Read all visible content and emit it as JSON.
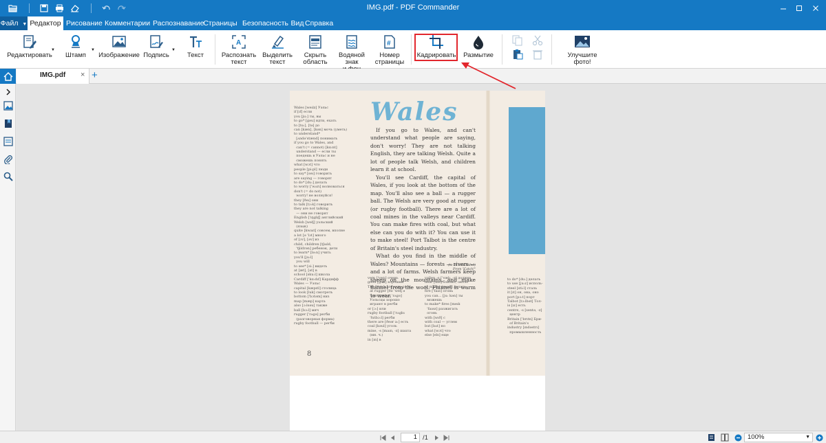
{
  "window": {
    "title": "IMG.pdf - PDF Commander"
  },
  "menu": {
    "file": "Файл",
    "items": [
      "Редактор",
      "Рисование",
      "Комментарии",
      "Распознавание",
      "Страницы",
      "Безопасность",
      "Вид",
      "Справка"
    ],
    "active": "Редактор"
  },
  "ribbon": {
    "edit": "Редактировать",
    "stamp": "Штамп",
    "image": "Изображение",
    "signature": "Подпись",
    "text": "Текст",
    "recognize_line1": "Распознать",
    "recognize_line2": "текст",
    "highlight_line1": "Выделить",
    "highlight_line2": "текст",
    "hide_line1": "Скрыть",
    "hide_line2": "область",
    "watermark_line1": "Водяной знак",
    "watermark_line2": "и фон",
    "pagenum_line1": "Номер",
    "pagenum_line2": "страницы",
    "crop": "Кадрировать",
    "blur": "Размытие",
    "enhance": "Улучшите фото!",
    "highlight_color": "#e2262c"
  },
  "tabs": {
    "document": "IMG.pdf",
    "close_glyph": "×",
    "add_glyph": "+"
  },
  "document_page": {
    "title": "Wales",
    "paragraphs": [
      "If you go to Wales, and can't understand what people are saying, don't worry! They are not talking English, they are talking Welsh. Quite a lot of people talk Welsh, and children learn it at school.",
      "You'll see Cardiff, the capital of Wales, if you look at the bottom of the map. You'll also see a ball — a rugger ball. The Welsh are very good at rugger (or rugby football). There are a lot of coal mines in the valleys near Cardiff. You can make fires with coal, but what else can you do with it? You can use it to make steel! Port Talbot is the centre of Britain's steel industry.",
      "What do you find in the middle of Wales? Mountains — forests — rivers — and a lot of farms. Welsh farmers keep sheep on the mountains, and make flannel from the wool. Flannel is warm to wear."
    ],
    "signoff": "(to be concluded)\nFrom \"Catch!\"",
    "page_number": "8",
    "gloss_left": "Wales [weılz] Уэльс\nif [ıf] если\nyou [ju:] ты, вы\nto go* [gəu] идти, ехать\nto [tu:], [tə] до\ncan [kæn], [kən] мочь (уметь)\nto understand*\n  [ʌndə'stænd] понимать\nif you go to Wales, and\n  can't (= cannot) [kɑ:nt]\n  understand — если ты\n  поедешь в Уэльс и не\n  сможешь понять\nwhat [wɔt] что\npeople [pi:pl] люди\nto say* [seı] говорить\nare saying — говорят\nto do* [du:] делать\nto worry ['wʌrı] волноваться\ndon't (= do not)\n  worry! не волнуйся!\nthey [ðeı] они\nto talk [tɔ:k] говорить\nthey are not talking\n  — они не говорят\nEnglish ['ıŋglıʃ] английский\nWelsh [welʃ] уэльский\n  (язык)\nquite [kwaıt] совсем, вполне\na lot [ə 'lɔt] много\nof [ɔv], [əv] из\nchild, children [tʃaıld,\n  'tʃıldrən] ребенок, дети\nto learn* [lə:n] учить\nyou'll [ju:l]\n  you will\nto see* [si:] видеть\nat [æt], [ət] в\nschool [sku:l] школа\nCardiff ['kɑ:dıf] Кардифф\nWales — Уэльс\ncapital [kæpıtl] столица\nto look [luk] смотреть\nbottom ['bɔtəm] низ\nmap [mæp] карта\nalso [ɔ:lsəu] также\nball [bɔ:l] мяч\nrugger ['rʌgə] регби\n  (разговорная форма)\nrugby football — регби",
    "col3": "very ['verı] очень\ngood [gud] хороший\nThe Welsh are very good\n  at rugger [ðə 'welʃ ə\n  'verı 'gud ət 'rʌgə]\n  Уэльсцы хорошо\n  играют в регби\nor [ɔ:] или\nrugby football ['rʌgbı\n  'futbɔ:l] регби\nthere are [ðeər a:] есть\ncoal [kəul] уголь\nmine, -s [maın, -z] шахта\n  (мн. ч.)\nin [ın] в",
    "col4": "valley, -s ['vælı, -z] долина\nnear [nıə] близко, около\nto make* [meık] делать\nfire ['faıə] огонь\nyou can... [ju: kən] ты\n  можешь\nto make* fires [meık\n  'faıəz] разжигать\n  огонь\nwith [wıð] с\nwith coal — углем\nbut [bʌt] но\nwhat [wɔt] что\nelse [els] еще",
    "col5": "to do* [du:] делать\nto use [ju:z] исполь-\nsteel [sti:l] сталь\nit [ıt] он, она, оно\nport [pɔ:t] порт\nTalbot [tɔ:lbət] Тол-\nis [ız] есть\ncentre, -s [sentə, -z]\n  центр\nBritain ['brıtn] Бри-\n  of Britain's\nindustry [ındəstrı]\n  промышленность"
  },
  "statusbar": {
    "current_page": "1",
    "total_pages": "/1",
    "zoom": "100%"
  }
}
